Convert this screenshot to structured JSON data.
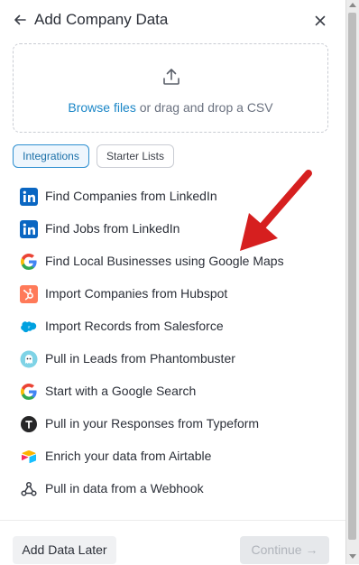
{
  "header": {
    "title": "Add Company Data"
  },
  "dropzone": {
    "link_text": "Browse files",
    "rest_text": " or drag and drop a CSV"
  },
  "tabs": [
    {
      "label": "Integrations",
      "active": true
    },
    {
      "label": "Starter Lists",
      "active": false
    }
  ],
  "integrations": [
    {
      "label": "Find Companies from LinkedIn",
      "icon": "linkedin-icon"
    },
    {
      "label": "Find Jobs from LinkedIn",
      "icon": "linkedin-icon"
    },
    {
      "label": "Find Local Businesses using Google Maps",
      "icon": "google-icon"
    },
    {
      "label": "Import Companies from Hubspot",
      "icon": "hubspot-icon"
    },
    {
      "label": "Import Records from Salesforce",
      "icon": "salesforce-icon"
    },
    {
      "label": "Pull in Leads from Phantombuster",
      "icon": "phantombuster-icon"
    },
    {
      "label": "Start with a Google Search",
      "icon": "google-icon"
    },
    {
      "label": "Pull in your Responses from Typeform",
      "icon": "typeform-icon"
    },
    {
      "label": "Enrich your data from Airtable",
      "icon": "airtable-icon"
    },
    {
      "label": "Pull in data from a Webhook",
      "icon": "webhook-icon"
    }
  ],
  "footer": {
    "later_label": "Add Data Later",
    "continue_label": "Continue"
  },
  "colors": {
    "accent": "#1a86c7",
    "annotation_arrow": "#d61f1f"
  }
}
